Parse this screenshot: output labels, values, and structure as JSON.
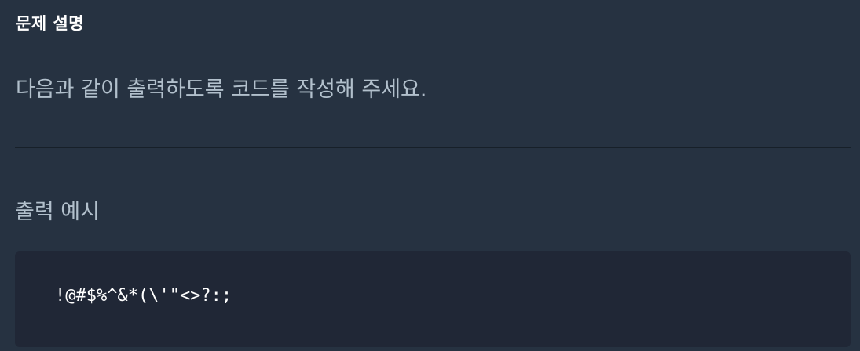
{
  "problem": {
    "heading": "문제 설명",
    "description": "다음과 같이 출력하도록 코드를 작성해 주세요.",
    "output_heading": "출력 예시",
    "output_example": "!@#$%^&*(\\'\"<>?:;"
  },
  "colors": {
    "background": "#263241",
    "code_background": "#202736",
    "divider": "#172029",
    "heading_text": "#ffffff",
    "body_text": "#b2c0cc"
  }
}
